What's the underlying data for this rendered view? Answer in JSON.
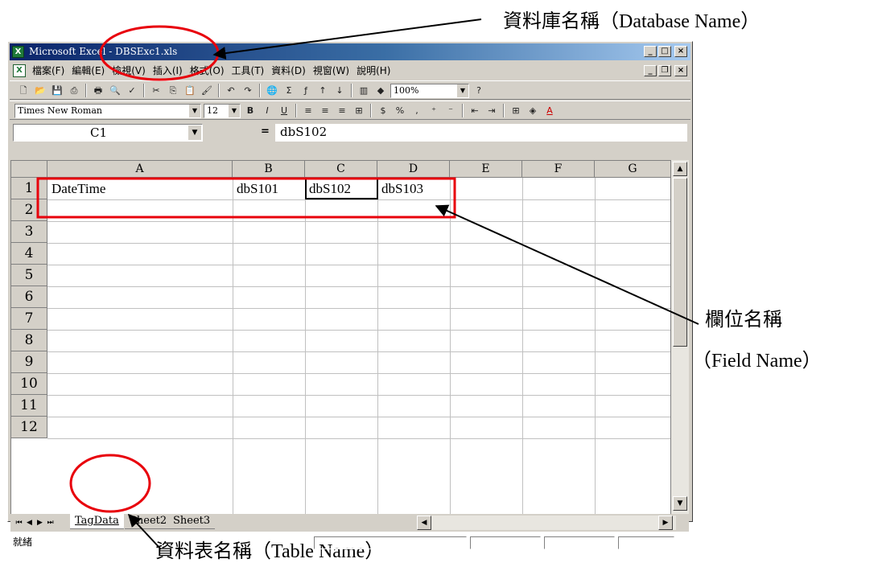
{
  "window": {
    "title": "Microsoft Excel - DBSExc1.xls",
    "app_icon": "excel-app-icon",
    "caption_buttons": [
      "_",
      "□",
      "×"
    ],
    "doc_buttons": [
      "_",
      "❐",
      "×"
    ]
  },
  "menubar": {
    "items": [
      "檔案(F)",
      "編輯(E)",
      "檢視(V)",
      "插入(I)",
      "格式(O)",
      "工具(T)",
      "資料(D)",
      "視窗(W)",
      "說明(H)"
    ]
  },
  "toolbar_standard": {
    "zoom": "100%"
  },
  "toolbar_format": {
    "font_name": "Times New Roman",
    "font_size": "12"
  },
  "formula_bar": {
    "name_box": "C1",
    "equals": "=",
    "content": "dbS102"
  },
  "sheet": {
    "columns": [
      "A",
      "B",
      "C",
      "D",
      "E",
      "F",
      "G"
    ],
    "rows": [
      "1",
      "2",
      "3",
      "4",
      "5",
      "6",
      "7",
      "8",
      "9",
      "10",
      "11",
      "12"
    ],
    "row1": {
      "A": "DateTime",
      "B": "dbS101",
      "C": "dbS102",
      "D": "dbS103"
    }
  },
  "tabs": {
    "sheets": [
      "TagData",
      "Sheet2",
      "Sheet3"
    ],
    "active": "TagData"
  },
  "status": {
    "text": "就緒"
  },
  "annotations": {
    "database_name": "資料庫名稱（Database Name）",
    "field_name_zh": "欄位名稱",
    "field_name_en": "（Field Name）",
    "table_name": "資料表名稱（Table Name）",
    "highlight_color": "#e8000b"
  }
}
